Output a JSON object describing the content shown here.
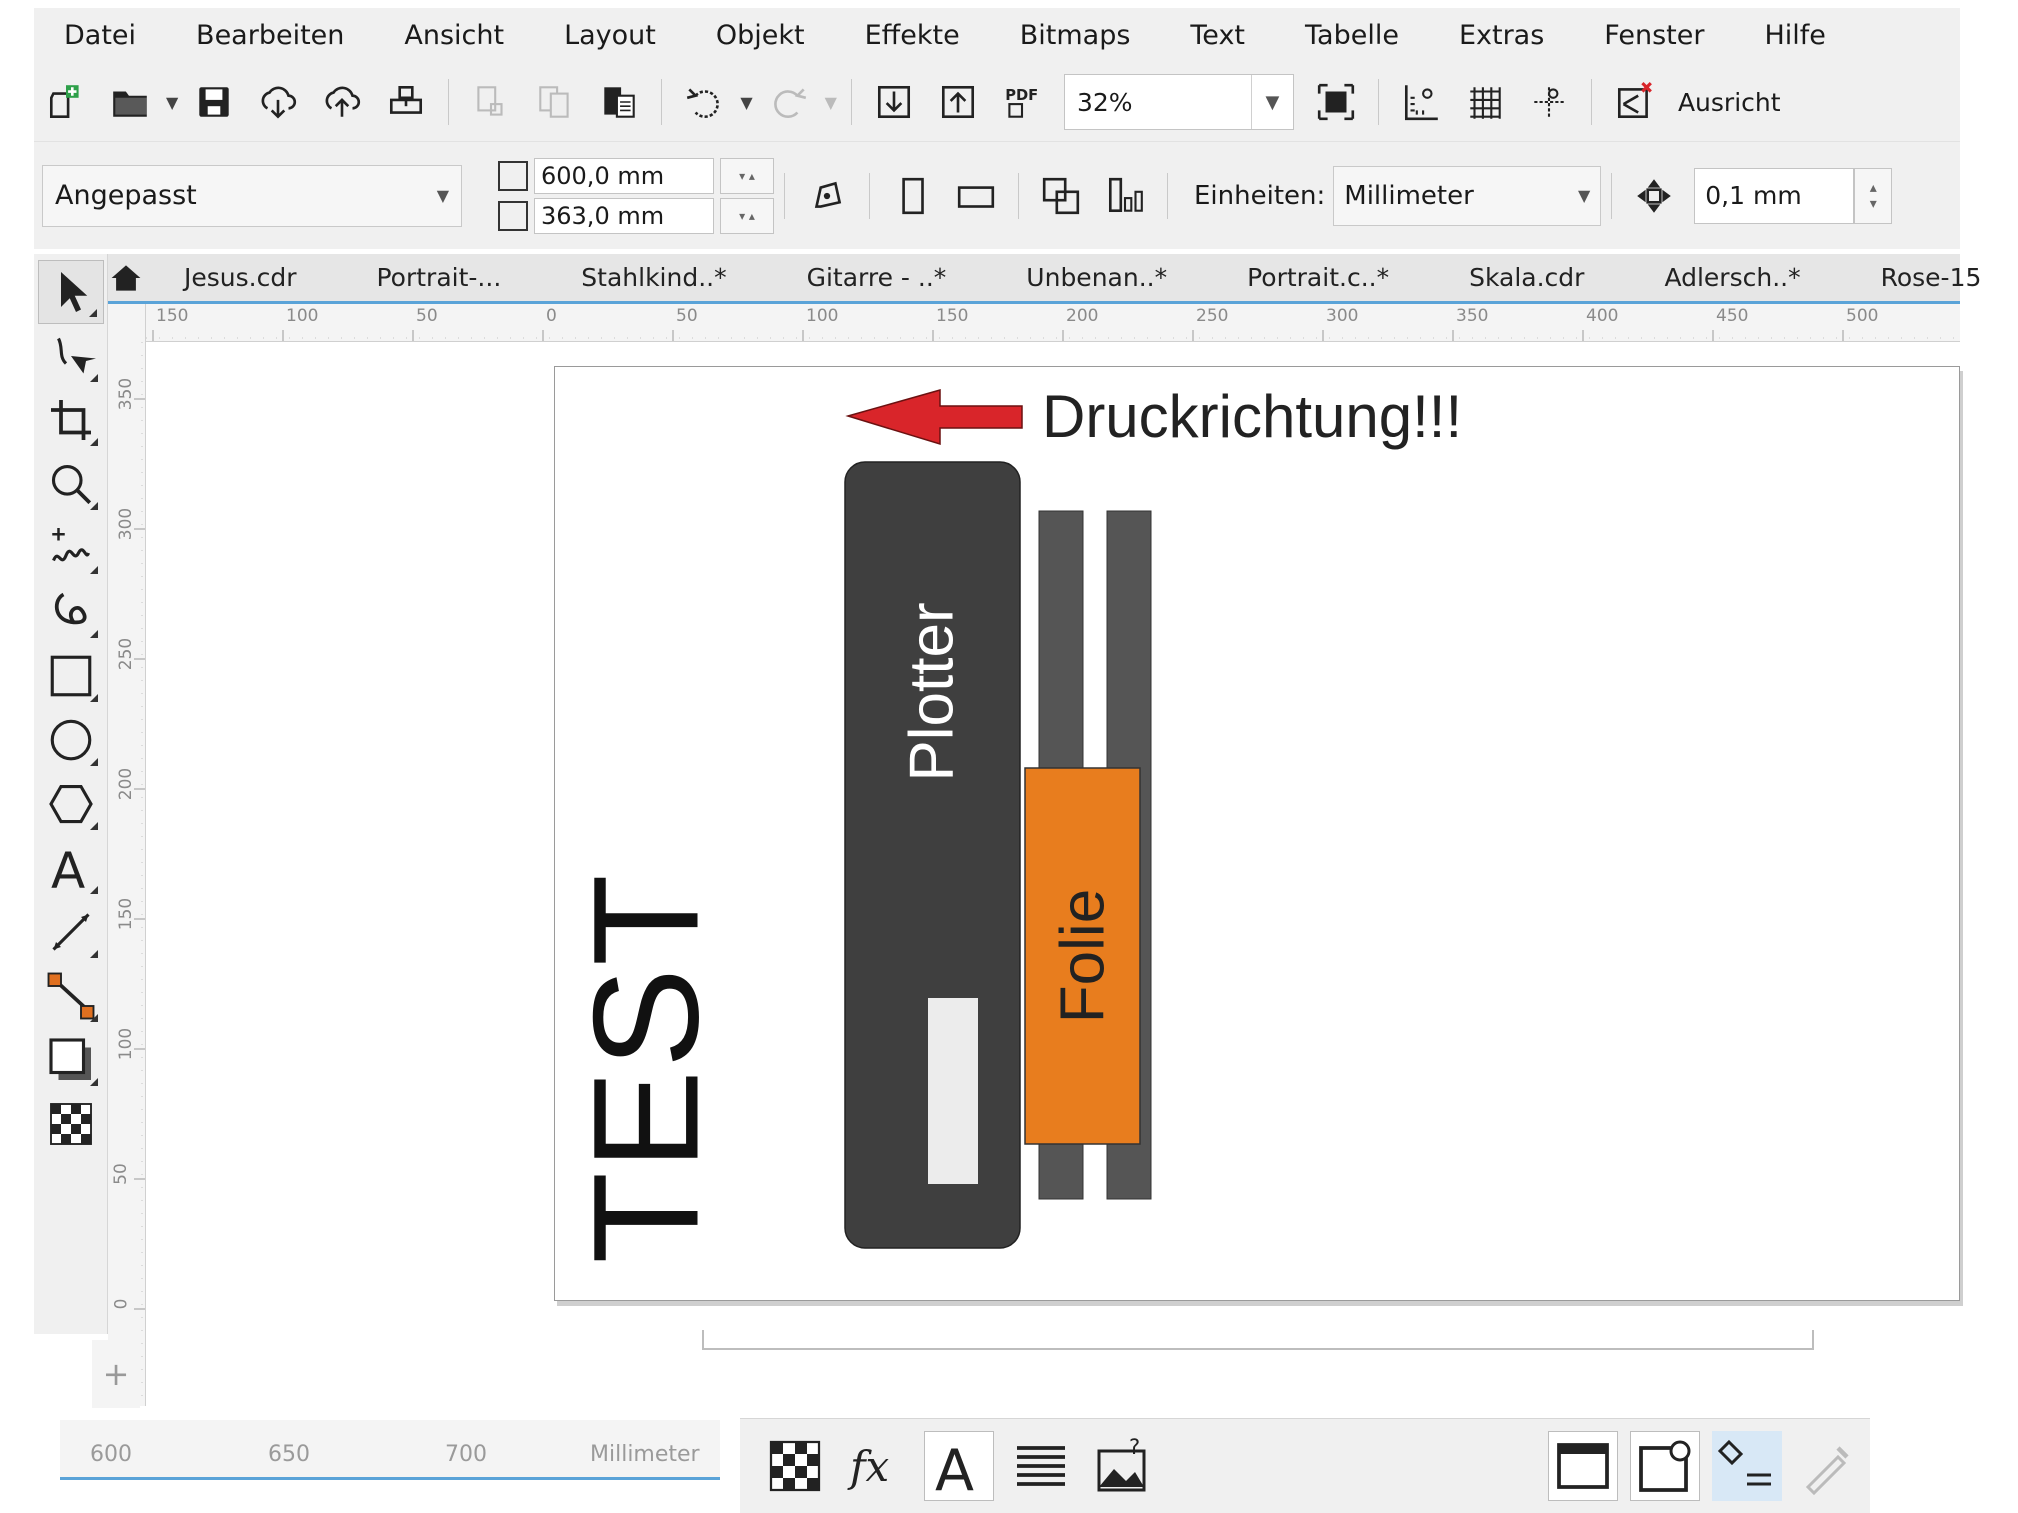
{
  "menu": [
    "Datei",
    "Bearbeiten",
    "Ansicht",
    "Layout",
    "Objekt",
    "Effekte",
    "Bitmaps",
    "Text",
    "Tabelle",
    "Extras",
    "Fenster",
    "Hilfe"
  ],
  "toolbar": {
    "zoom_value": "32%",
    "snap_label": "Ausricht"
  },
  "property_bar": {
    "preset": "Angepasst",
    "width": "600,0 mm",
    "height": "363,0 mm",
    "units_label": "Einheiten:",
    "units_value": "Millimeter",
    "nudge": "0,1 mm"
  },
  "tabs": [
    "Jesus.cdr",
    "Portrait-...",
    "Stahlkind..*",
    "Gitarre - ..*",
    "Unbenan..*",
    "Portrait.c..*",
    "Skala.cdr",
    "Adlersch..*",
    "Rose-15"
  ],
  "rulers": {
    "horizontal": [
      "150",
      "100",
      "50",
      "0",
      "50",
      "100",
      "150",
      "200",
      "250",
      "300",
      "350",
      "400",
      "450",
      "500"
    ],
    "vertical": [
      "350",
      "300",
      "250",
      "200",
      "150",
      "100",
      "50",
      "0"
    ],
    "bottom": [
      "600",
      "650",
      "700",
      "Millimeter"
    ]
  },
  "drawing": {
    "direction_label": "Druckrichtung!!!",
    "plotter_label": "Plotter",
    "folie_label": "Folie",
    "test_label": "TEST"
  },
  "colors": {
    "plotter": "#3f3f3f",
    "rollers": "#555555",
    "folie": "#e87d1e",
    "arrow": "#d9252a",
    "tab_accent": "#5aa3d8"
  },
  "icons": [
    "new-doc-icon",
    "open-icon",
    "save-icon",
    "cloud-download-icon",
    "cloud-upload-icon",
    "print-icon",
    "cut-icon",
    "copy-icon",
    "paste-icon",
    "undo-icon",
    "redo-icon",
    "import-icon",
    "export-icon",
    "pdf-icon",
    "fullscreen-icon",
    "rulers-icon",
    "grid-icon",
    "guides-icon",
    "snap-off-icon"
  ]
}
